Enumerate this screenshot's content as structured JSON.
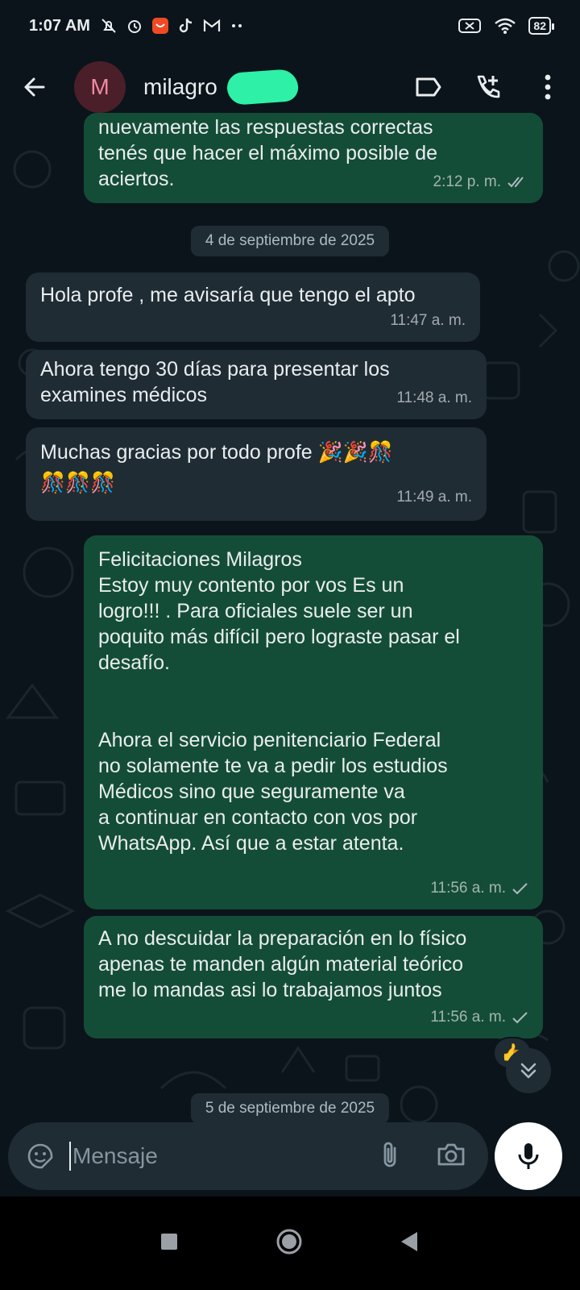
{
  "status_bar": {
    "time": "1:07 AM",
    "battery": "82",
    "left_icons": [
      "mute-icon",
      "alarm-icon",
      "shopping-app-icon",
      "tiktok-icon",
      "gmail-icon",
      "more-dots-icon"
    ],
    "right_icons": [
      "no-sim-icon",
      "wifi-icon",
      "battery-icon"
    ]
  },
  "header": {
    "avatar_letter": "M",
    "contact_name": "milagro",
    "actions": [
      "label-icon",
      "add-call-icon",
      "more-vert-icon"
    ]
  },
  "messages": [
    {
      "direction": "out",
      "text": "nuevamente las respuestas correctas\ntenés que hacer el máximo posible de\naciertos.",
      "time": "2:12 p. m.",
      "status": "read"
    },
    {
      "type": "date",
      "text": "4 de septiembre de 2025"
    },
    {
      "direction": "in",
      "text": "Hola profe , me avisaría que tengo el apto",
      "time": "11:47 a. m."
    },
    {
      "direction": "in",
      "text": "Ahora tengo 30 días para presentar los\nexamines médicos",
      "time": "11:48 a. m."
    },
    {
      "direction": "in",
      "text": "Muchas gracias por todo profe 🎉🎉🎊\n🎊🎊🎊",
      "time": "11:49 a. m."
    },
    {
      "direction": "out",
      "text": "Felicitaciones Milagros\nEstoy muy contento por vos Es un\nlogro!!! . Para oficiales suele ser un\npoquito más difícil pero lograste pasar el\ndesafío.\n\n\nAhora el servicio penitenciario Federal\nno solamente te va a pedir los estudios\nMédicos sino que seguramente va\na continuar en contacto con vos por\nWhatsApp. Así que a estar atenta.",
      "time": "11:56 a. m.",
      "status": "sent"
    },
    {
      "direction": "out",
      "text": "A no descuidar la preparación en lo físico\napenas te manden algún material teórico\nme lo mandas asi lo trabajamos juntos",
      "time": "11:56 a. m.",
      "status": "sent",
      "reaction": "👍"
    },
    {
      "type": "date",
      "text": "5 de septiembre de 2025"
    }
  ],
  "input": {
    "placeholder": "Mensaje"
  },
  "colors": {
    "background": "#0b141a",
    "incoming_bubble": "#1f2c34",
    "outgoing_bubble": "#144d37",
    "redaction": "#2ef0a6"
  }
}
